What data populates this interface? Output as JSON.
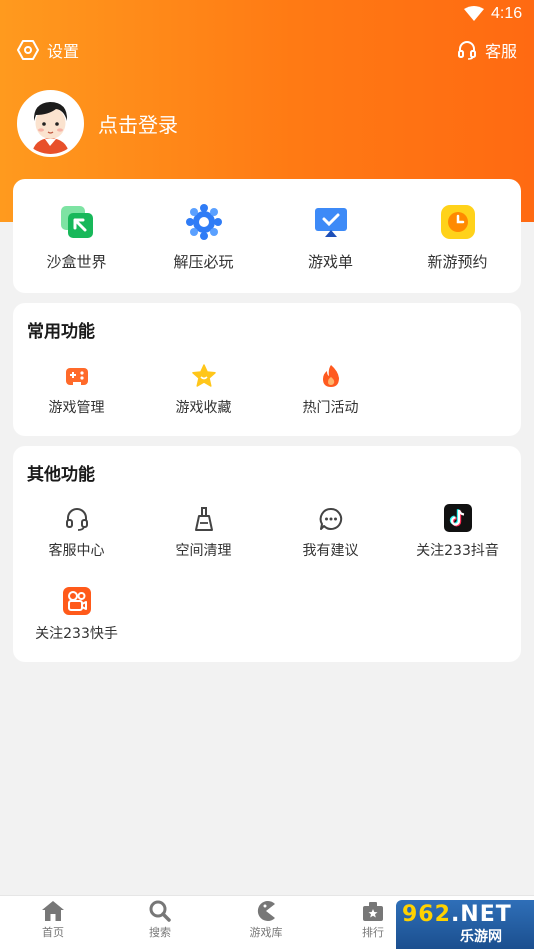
{
  "status_bar": {
    "time": "4:16",
    "wifi_icon": "wifi-icon"
  },
  "header": {
    "settings_label": "设置",
    "support_label": "客服",
    "login_label": "点击登录"
  },
  "quick_grid": [
    {
      "label": "沙盒世界",
      "icon": "sandbox-icon"
    },
    {
      "label": "解压必玩",
      "icon": "gear-blue-icon"
    },
    {
      "label": "游戏单",
      "icon": "game-list-icon"
    },
    {
      "label": "新游预约",
      "icon": "clock-icon"
    }
  ],
  "common": {
    "title": "常用功能",
    "items": [
      {
        "label": "游戏管理",
        "icon": "gamepad-icon"
      },
      {
        "label": "游戏收藏",
        "icon": "star-icon"
      },
      {
        "label": "热门活动",
        "icon": "fire-icon"
      }
    ]
  },
  "other": {
    "title": "其他功能",
    "items": [
      {
        "label": "客服中心",
        "icon": "headset-icon"
      },
      {
        "label": "空间清理",
        "icon": "broom-icon"
      },
      {
        "label": "我有建议",
        "icon": "chat-icon"
      },
      {
        "label": "关注233抖音",
        "icon": "tiktok-icon"
      },
      {
        "label": "关注233快手",
        "icon": "kuaishou-icon"
      }
    ]
  },
  "tabbar": [
    {
      "label": "首页",
      "icon": "home-icon"
    },
    {
      "label": "搜索",
      "icon": "search-icon"
    },
    {
      "label": "游戏库",
      "icon": "pacman-icon"
    },
    {
      "label": "排行",
      "icon": "rank-icon"
    }
  ],
  "watermark": {
    "main": "962",
    "suffix": ".NET",
    "sub": "乐游网"
  },
  "colors": {
    "accent": "#ff7a14",
    "card": "#ffffff",
    "background": "#f2f2f2"
  }
}
